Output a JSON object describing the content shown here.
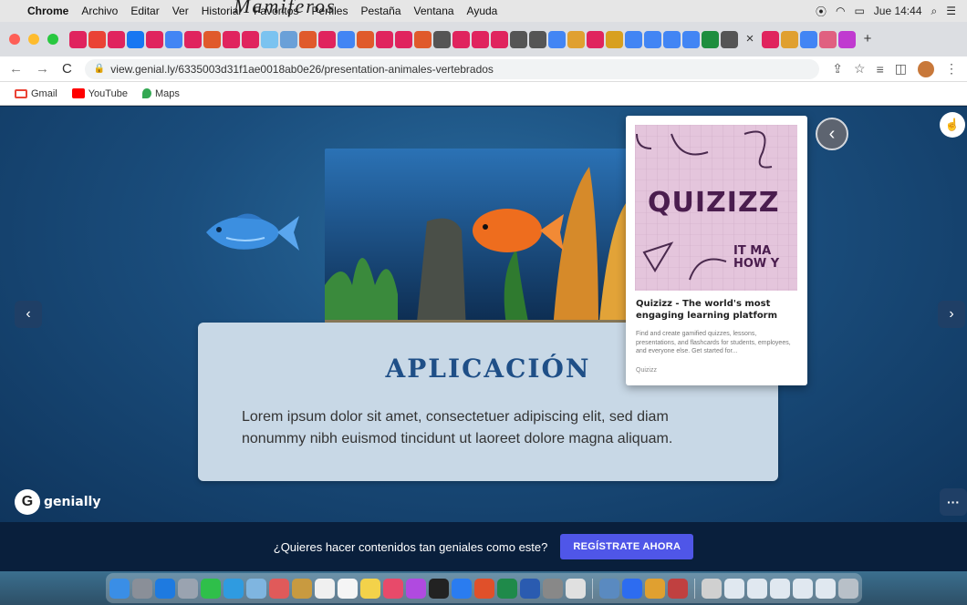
{
  "overlay_title": "Mamiferos",
  "menubar": {
    "app": "Chrome",
    "items": [
      "Archivo",
      "Editar",
      "Ver",
      "Historial",
      "Favoritos",
      "Perfiles",
      "Pestaña",
      "Ventana",
      "Ayuda"
    ],
    "clock": "Jue 14:44"
  },
  "browser": {
    "url": "view.genial.ly/6335003d31f1ae0018ab0e26/presentation-animales-vertebrados",
    "bookmarks": [
      "Gmail",
      "YouTube",
      "Maps"
    ]
  },
  "slide": {
    "heading": "APLICACIÓN",
    "body": "Lorem ipsum dolor sit amet, consectetuer adipiscing elit, sed diam nonummy nibh euismod tincidunt ut laoreet dolore magna aliquam.",
    "brand": "genially"
  },
  "popup": {
    "image_text": "QUIZIZZ",
    "image_subtext": "IT MA HOW Y",
    "title": "Quizizz - The world's most engaging learning platform",
    "description": "Find and create gamified quizzes, lessons, presentations, and flashcards for students, employees, and everyone else. Get started for...",
    "source": "Quizizz"
  },
  "footer": {
    "prompt": "¿Quieres hacer contenidos tan geniales como este?",
    "cta": "REGÍSTRATE AHORA"
  },
  "colors": {
    "slide_bg": "#1a4d7c",
    "card_bg": "#c8d8e6",
    "heading": "#1f4f87",
    "cta": "#4f56e8",
    "footer_bg": "#091f3c"
  }
}
